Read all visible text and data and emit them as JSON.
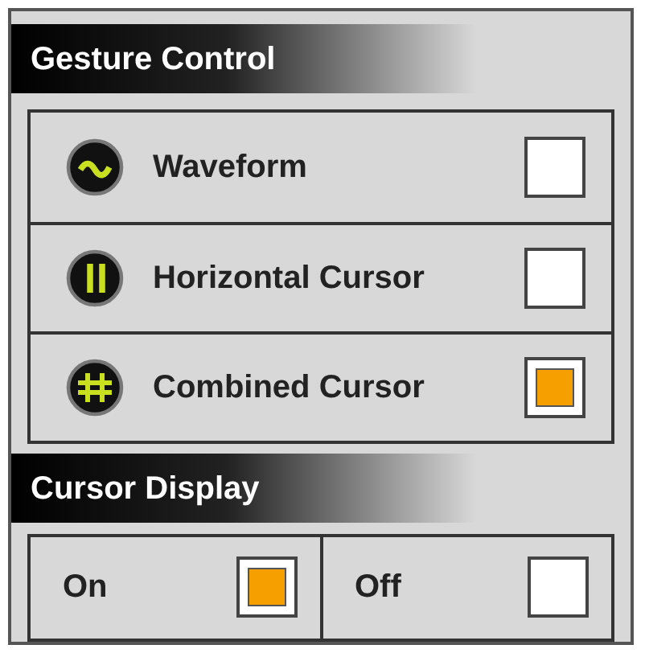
{
  "gesture_control": {
    "title": "Gesture Control",
    "options": [
      {
        "label": "Waveform",
        "kind": "waveform",
        "checked": false
      },
      {
        "label": "Horizontal Cursor",
        "kind": "horizontal",
        "checked": false
      },
      {
        "label": "Combined Cursor",
        "kind": "combined",
        "checked": true
      }
    ]
  },
  "cursor_display": {
    "title": "Cursor Display",
    "options": [
      {
        "label": "On",
        "checked": true
      },
      {
        "label": "Off",
        "checked": false
      }
    ]
  }
}
